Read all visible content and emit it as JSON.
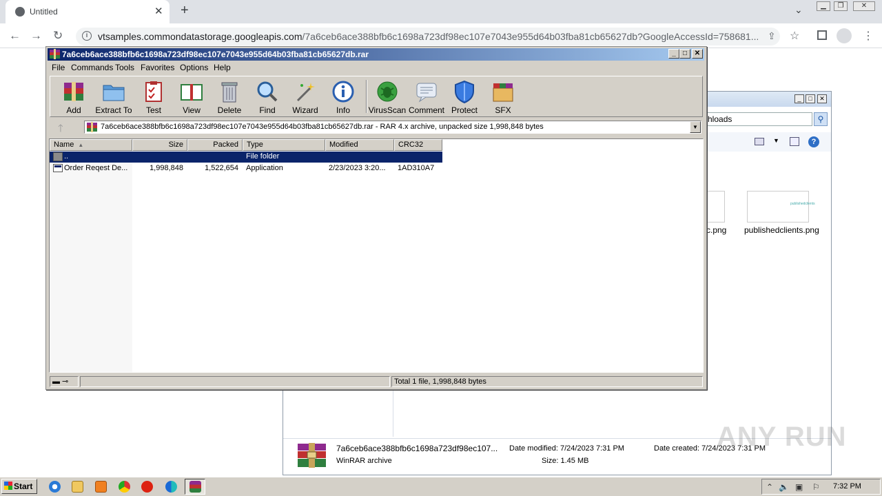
{
  "browser": {
    "tab_title": "Untitled",
    "tab_close": "✕",
    "new_tab": "+",
    "url_host": "vtsamples.commondatastorage.googleapis.com",
    "url_path": "/7a6ceb6ace388bfb6c1698a723df98ec107e7043e955d64b03fba81cb65627db?GoogleAccessId=758681..."
  },
  "winrar": {
    "title": "7a6ceb6ace388bfb6c1698a723df98ec107e7043e955d64b03fba81cb65627db.rar",
    "menu": [
      "File",
      "Commands",
      "Tools",
      "Favorites",
      "Options",
      "Help"
    ],
    "toolbar": [
      "Add",
      "Extract To",
      "Test",
      "View",
      "Delete",
      "Find",
      "Wizard",
      "Info",
      "VirusScan",
      "Comment",
      "Protect",
      "SFX"
    ],
    "path": "7a6ceb6ace388bfb6c1698a723df98ec107e7043e955d64b03fba81cb65627db.rar - RAR 4.x archive, unpacked size 1,998,848 bytes",
    "columns": [
      "Name",
      "Size",
      "Packed",
      "Type",
      "Modified",
      "CRC32"
    ],
    "rows": [
      {
        "name": "..",
        "size": "",
        "packed": "",
        "type": "File folder",
        "modified": "",
        "crc": ""
      },
      {
        "name": "Order Reqest De...",
        "size": "1,998,848",
        "packed": "1,522,654",
        "type": "Application",
        "modified": "2/23/2023 3:20...",
        "crc": "1AD310A7"
      }
    ],
    "status": "Total 1 file, 1,998,848 bytes"
  },
  "explorer": {
    "search_text": "hloads",
    "file1_label": "c.png",
    "file2_label": "publishedclients.png",
    "file2_thumb_text": "publishedclients",
    "details": {
      "name": "7a6ceb6ace388bfb6c1698a723df98ec107...",
      "type": "WinRAR archive",
      "modified": "Date modified: 7/24/2023 7:31 PM",
      "size": "Size: 1.45 MB",
      "created": "Date created: 7/24/2023 7:31 PM"
    }
  },
  "taskbar": {
    "start": "Start",
    "time": "7:32 PM"
  },
  "watermark": "ANY RUN",
  "colors": {
    "selection": "#0a246a",
    "titlebar_start": "#0a246a",
    "titlebar_end": "#a6caf0",
    "window_face": "#d4d0c8"
  }
}
